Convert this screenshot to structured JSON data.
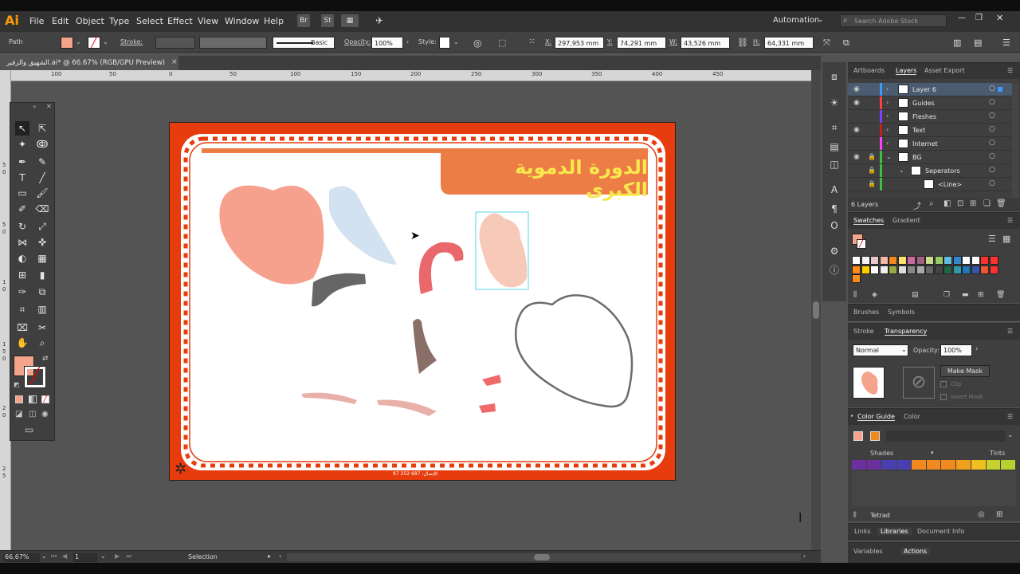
{
  "app": {
    "logo": "Ai",
    "menu": [
      "File",
      "Edit",
      "Object",
      "Type",
      "Select",
      "Effect",
      "View",
      "Window",
      "Help"
    ],
    "bridge_label": "Br",
    "stock_label": "St",
    "workspace": "Automation",
    "search_placeholder": "Search Adobe Stock"
  },
  "control": {
    "object_type": "Path",
    "fill_color": "#f4a38c",
    "stroke_label": "Stroke:",
    "brush_label": "Basic",
    "opacity_label": "Opacity:",
    "opacity_value": "100%",
    "style_label": "Style:",
    "x_label": "X:",
    "x_value": "297,953 mm",
    "y_label": "Y:",
    "y_value": "74,291 mm",
    "w_label": "W:",
    "w_value": "43,526 mm",
    "h_label": "H:",
    "h_value": "64,331 mm"
  },
  "document": {
    "tab_title": "الشهيق والزفير.ai* @ 66.67% (RGB/GPU Preview)",
    "close_label": "×"
  },
  "rulers": {
    "h_ticks": [
      "100",
      "50",
      "0",
      "50",
      "100",
      "150",
      "200",
      "250",
      "300",
      "350",
      "400",
      "450"
    ],
    "v_ticks": [
      "5",
      "0",
      "5",
      "0",
      "1",
      "0",
      "1",
      "5",
      "0",
      "2",
      "0",
      "2",
      "5"
    ]
  },
  "artboard": {
    "title": "الدورة الدموية الكبرى",
    "footer": "الإتصال: 687 252 97"
  },
  "layers_panel": {
    "tabs": [
      "Artboards",
      "Layers",
      "Asset Export"
    ],
    "active_tab": "Layers",
    "rows": [
      {
        "name": "Layer 6",
        "color": "#3d9cff",
        "visible": true,
        "expanded": false,
        "selected": true
      },
      {
        "name": "Guides",
        "color": "#ff4040",
        "visible": true,
        "expanded": false,
        "selected": false
      },
      {
        "name": "Fleshes",
        "color": "#8040ff",
        "visible": false,
        "expanded": false,
        "selected": false
      },
      {
        "name": "Text",
        "color": "#c02020",
        "visible": true,
        "expanded": false,
        "selected": false
      },
      {
        "name": "Internet",
        "color": "#ff40ff",
        "visible": false,
        "expanded": false,
        "selected": false
      },
      {
        "name": "BG",
        "color": "#40c040",
        "visible": true,
        "expanded": true,
        "selected": false
      },
      {
        "name": "Seperators",
        "color": "#40c040",
        "visible": false,
        "expanded": true,
        "selected": false
      },
      {
        "name": "<Line>",
        "color": "#40c040",
        "visible": false,
        "expanded": false,
        "selected": false
      }
    ],
    "count": "6 Layers"
  },
  "swatches_panel": {
    "tabs": [
      "Swatches",
      "Gradient"
    ]
  },
  "brushes_panel": {
    "tabs": [
      "Brushes",
      "Symbols"
    ]
  },
  "transparency_panel": {
    "tabs": [
      "Stroke",
      "Transparency"
    ],
    "blend_mode": "Normal",
    "opacity_label": "Opacity:",
    "opacity_value": "100%",
    "make_mask": "Make Mask",
    "clip": "Clip",
    "invert_mask": "Invert Mask"
  },
  "color_guide_panel": {
    "tabs": [
      "Color Guide",
      "Color"
    ],
    "shades": "Shades",
    "tints": "Tints",
    "harmony": "Tetrad",
    "base_colors": [
      "#f4a38c",
      "#f08a1e"
    ],
    "guide_colors": [
      "#6b2fa0",
      "#6b2fa0",
      "#4a3fb0",
      "#4a3fb0",
      "#f08a1e",
      "#f08a1e",
      "#f08a1e",
      "#f0a020",
      "#f0c020",
      "#c8d030",
      "#b8d030"
    ]
  },
  "bottom_tabs": {
    "row1": [
      "Links",
      "Libraries",
      "Document Info"
    ],
    "row2": [
      "Variables",
      "Actions"
    ]
  },
  "status_bar": {
    "zoom": "66,67%",
    "page": "1",
    "mode": "Selection"
  },
  "tools": {
    "fill_color": "#f4a38c"
  }
}
